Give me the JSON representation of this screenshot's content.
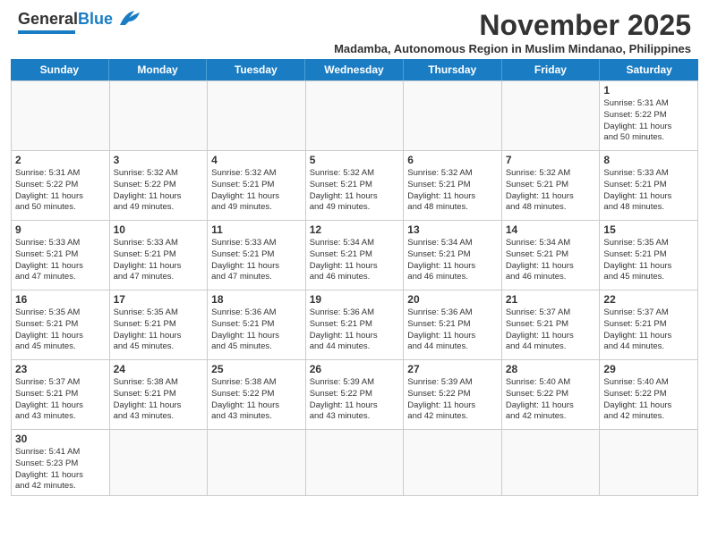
{
  "header": {
    "logo_general": "General",
    "logo_blue": "Blue",
    "month_title": "November 2025",
    "subtitle": "Madamba, Autonomous Region in Muslim Mindanao, Philippines"
  },
  "days_of_week": [
    "Sunday",
    "Monday",
    "Tuesday",
    "Wednesday",
    "Thursday",
    "Friday",
    "Saturday"
  ],
  "weeks": [
    [
      {
        "day": "",
        "info": ""
      },
      {
        "day": "",
        "info": ""
      },
      {
        "day": "",
        "info": ""
      },
      {
        "day": "",
        "info": ""
      },
      {
        "day": "",
        "info": ""
      },
      {
        "day": "",
        "info": ""
      },
      {
        "day": "1",
        "info": "Sunrise: 5:31 AM\nSunset: 5:22 PM\nDaylight: 11 hours\nand 50 minutes."
      }
    ],
    [
      {
        "day": "2",
        "info": "Sunrise: 5:31 AM\nSunset: 5:22 PM\nDaylight: 11 hours\nand 50 minutes."
      },
      {
        "day": "3",
        "info": "Sunrise: 5:32 AM\nSunset: 5:22 PM\nDaylight: 11 hours\nand 49 minutes."
      },
      {
        "day": "4",
        "info": "Sunrise: 5:32 AM\nSunset: 5:21 PM\nDaylight: 11 hours\nand 49 minutes."
      },
      {
        "day": "5",
        "info": "Sunrise: 5:32 AM\nSunset: 5:21 PM\nDaylight: 11 hours\nand 49 minutes."
      },
      {
        "day": "6",
        "info": "Sunrise: 5:32 AM\nSunset: 5:21 PM\nDaylight: 11 hours\nand 48 minutes."
      },
      {
        "day": "7",
        "info": "Sunrise: 5:32 AM\nSunset: 5:21 PM\nDaylight: 11 hours\nand 48 minutes."
      },
      {
        "day": "8",
        "info": "Sunrise: 5:33 AM\nSunset: 5:21 PM\nDaylight: 11 hours\nand 48 minutes."
      }
    ],
    [
      {
        "day": "9",
        "info": "Sunrise: 5:33 AM\nSunset: 5:21 PM\nDaylight: 11 hours\nand 47 minutes."
      },
      {
        "day": "10",
        "info": "Sunrise: 5:33 AM\nSunset: 5:21 PM\nDaylight: 11 hours\nand 47 minutes."
      },
      {
        "day": "11",
        "info": "Sunrise: 5:33 AM\nSunset: 5:21 PM\nDaylight: 11 hours\nand 47 minutes."
      },
      {
        "day": "12",
        "info": "Sunrise: 5:34 AM\nSunset: 5:21 PM\nDaylight: 11 hours\nand 46 minutes."
      },
      {
        "day": "13",
        "info": "Sunrise: 5:34 AM\nSunset: 5:21 PM\nDaylight: 11 hours\nand 46 minutes."
      },
      {
        "day": "14",
        "info": "Sunrise: 5:34 AM\nSunset: 5:21 PM\nDaylight: 11 hours\nand 46 minutes."
      },
      {
        "day": "15",
        "info": "Sunrise: 5:35 AM\nSunset: 5:21 PM\nDaylight: 11 hours\nand 45 minutes."
      }
    ],
    [
      {
        "day": "16",
        "info": "Sunrise: 5:35 AM\nSunset: 5:21 PM\nDaylight: 11 hours\nand 45 minutes."
      },
      {
        "day": "17",
        "info": "Sunrise: 5:35 AM\nSunset: 5:21 PM\nDaylight: 11 hours\nand 45 minutes."
      },
      {
        "day": "18",
        "info": "Sunrise: 5:36 AM\nSunset: 5:21 PM\nDaylight: 11 hours\nand 45 minutes."
      },
      {
        "day": "19",
        "info": "Sunrise: 5:36 AM\nSunset: 5:21 PM\nDaylight: 11 hours\nand 44 minutes."
      },
      {
        "day": "20",
        "info": "Sunrise: 5:36 AM\nSunset: 5:21 PM\nDaylight: 11 hours\nand 44 minutes."
      },
      {
        "day": "21",
        "info": "Sunrise: 5:37 AM\nSunset: 5:21 PM\nDaylight: 11 hours\nand 44 minutes."
      },
      {
        "day": "22",
        "info": "Sunrise: 5:37 AM\nSunset: 5:21 PM\nDaylight: 11 hours\nand 44 minutes."
      }
    ],
    [
      {
        "day": "23",
        "info": "Sunrise: 5:37 AM\nSunset: 5:21 PM\nDaylight: 11 hours\nand 43 minutes."
      },
      {
        "day": "24",
        "info": "Sunrise: 5:38 AM\nSunset: 5:21 PM\nDaylight: 11 hours\nand 43 minutes."
      },
      {
        "day": "25",
        "info": "Sunrise: 5:38 AM\nSunset: 5:22 PM\nDaylight: 11 hours\nand 43 minutes."
      },
      {
        "day": "26",
        "info": "Sunrise: 5:39 AM\nSunset: 5:22 PM\nDaylight: 11 hours\nand 43 minutes."
      },
      {
        "day": "27",
        "info": "Sunrise: 5:39 AM\nSunset: 5:22 PM\nDaylight: 11 hours\nand 42 minutes."
      },
      {
        "day": "28",
        "info": "Sunrise: 5:40 AM\nSunset: 5:22 PM\nDaylight: 11 hours\nand 42 minutes."
      },
      {
        "day": "29",
        "info": "Sunrise: 5:40 AM\nSunset: 5:22 PM\nDaylight: 11 hours\nand 42 minutes."
      }
    ],
    [
      {
        "day": "30",
        "info": "Sunrise: 5:41 AM\nSunset: 5:23 PM\nDaylight: 11 hours\nand 42 minutes."
      },
      {
        "day": "",
        "info": ""
      },
      {
        "day": "",
        "info": ""
      },
      {
        "day": "",
        "info": ""
      },
      {
        "day": "",
        "info": ""
      },
      {
        "day": "",
        "info": ""
      },
      {
        "day": "",
        "info": ""
      }
    ]
  ]
}
